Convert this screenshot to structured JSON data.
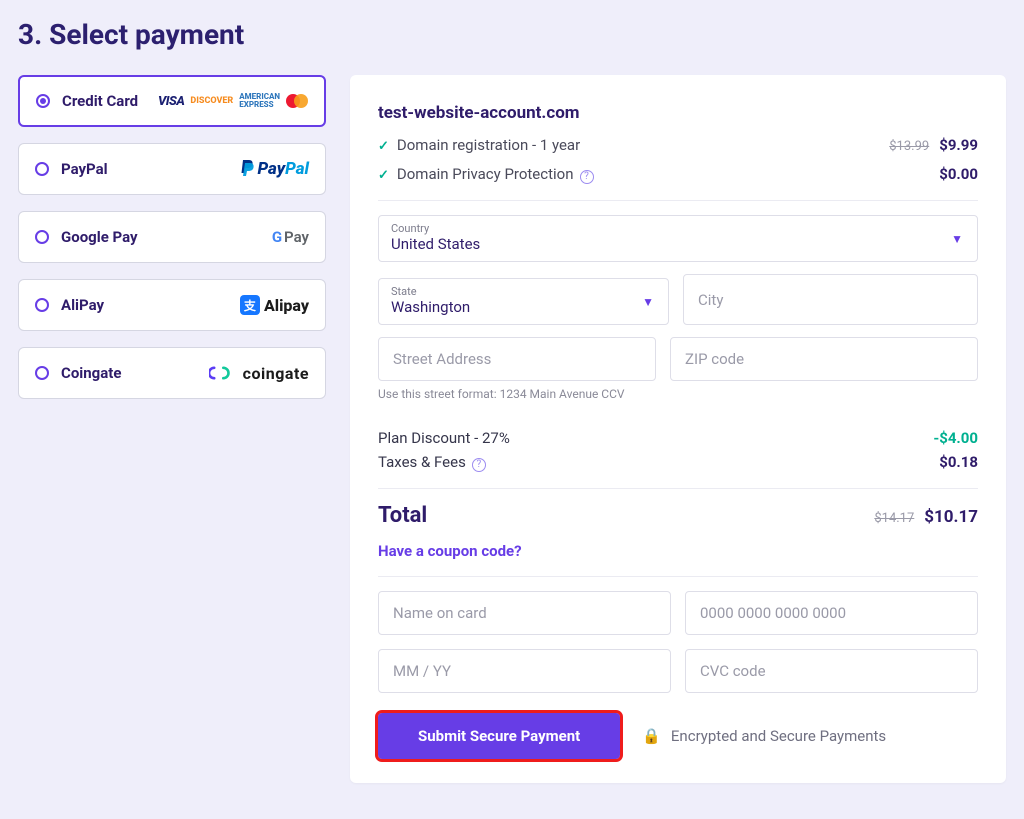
{
  "title": "3. Select payment",
  "methods": [
    {
      "id": "credit-card",
      "label": "Credit Card",
      "selected": true
    },
    {
      "id": "paypal",
      "label": "PayPal",
      "selected": false
    },
    {
      "id": "google-pay",
      "label": "Google Pay",
      "selected": false
    },
    {
      "id": "alipay",
      "label": "AliPay",
      "selected": false
    },
    {
      "id": "coingate",
      "label": "Coingate",
      "selected": false
    }
  ],
  "order": {
    "domain": "test-website-account.com",
    "items": [
      {
        "label": "Domain registration - 1 year",
        "old_price": "$13.99",
        "price": "$9.99",
        "info": false
      },
      {
        "label": "Domain Privacy Protection",
        "old_price": "",
        "price": "$0.00",
        "info": true
      }
    ],
    "plan_discount_label": "Plan Discount - 27%",
    "plan_discount_value": "-$4.00",
    "taxes_label": "Taxes & Fees",
    "taxes_value": "$0.18",
    "total_label": "Total",
    "total_old": "$14.17",
    "total_value": "$10.17",
    "coupon_text": "Have a coupon code?"
  },
  "address": {
    "country_label": "Country",
    "country_value": "United States",
    "state_label": "State",
    "state_value": "Washington",
    "city_placeholder": "City",
    "street_placeholder": "Street Address",
    "zip_placeholder": "ZIP code",
    "street_hint": "Use this street format: 1234 Main Avenue CCV"
  },
  "card": {
    "name_placeholder": "Name on card",
    "number_placeholder": "0000 0000 0000 0000",
    "expiry_placeholder": "MM / YY",
    "cvc_placeholder": "CVC code"
  },
  "cta": {
    "submit": "Submit Secure Payment",
    "secure_note": "Encrypted and Secure Payments"
  }
}
